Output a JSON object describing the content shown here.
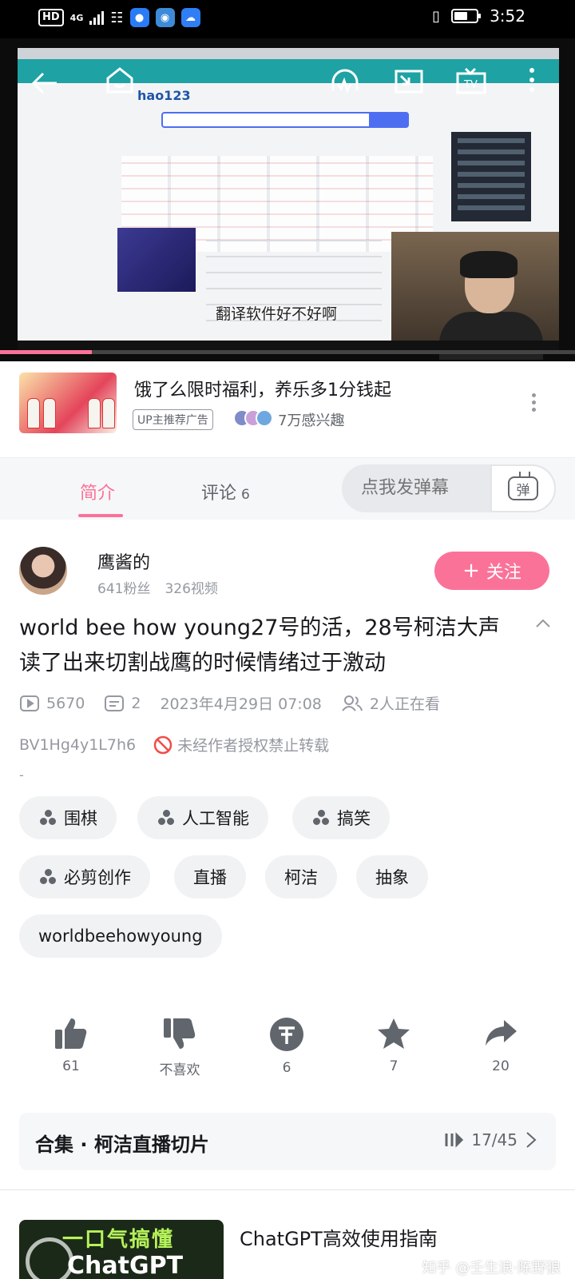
{
  "status_bar": {
    "hd": "HD",
    "network": "4G",
    "time": "3:52"
  },
  "player": {
    "subtitle": "翻译软件好不好啊",
    "progress_fraction": 0.16
  },
  "ad": {
    "title": "饿了么限时福利，养乐多1分钱起",
    "tag": "UP主推荐广告",
    "interest": "7万感兴趣"
  },
  "tabs": {
    "intro": "简介",
    "comments_label": "评论",
    "comments_count": "6",
    "danmaku_placeholder": "点我发弹幕",
    "danmaku_icon_text": "弹"
  },
  "uploader": {
    "name": "鹰酱的",
    "fans": "641粉丝",
    "videos": "326视频",
    "follow_label": "关注"
  },
  "video": {
    "title": "world bee how young27号的活，28号柯洁大声读了出来切割战鹰的时候情绪过于激动",
    "views": "5670",
    "danmaku_count": "2",
    "date": "2023年4月29日 07:08",
    "watching": "2人正在看",
    "bvid": "BV1Hg4y1L7h6",
    "copyright": "未经作者授权禁止转载",
    "desc": "-"
  },
  "tags": [
    "围棋",
    "人工智能",
    "搞笑",
    "必剪创作",
    "直播",
    "柯洁",
    "抽象",
    "worldbeehowyoung"
  ],
  "actions": {
    "like": "61",
    "dislike": "不喜欢",
    "coin": "6",
    "favorite": "7",
    "share": "20"
  },
  "collection": {
    "name": "合集 · 柯洁直播切片",
    "progress": "17/45"
  },
  "recommend": {
    "thumb_line1": "一口气搞懂",
    "thumb_line2": "ChatGPT",
    "title": "ChatGPT高效使用指南"
  },
  "watermark": "知乎 @壬生浪·陈野狼",
  "colors": {
    "accent": "#fb7299",
    "text": "#18191c",
    "muted": "#9499a0"
  }
}
